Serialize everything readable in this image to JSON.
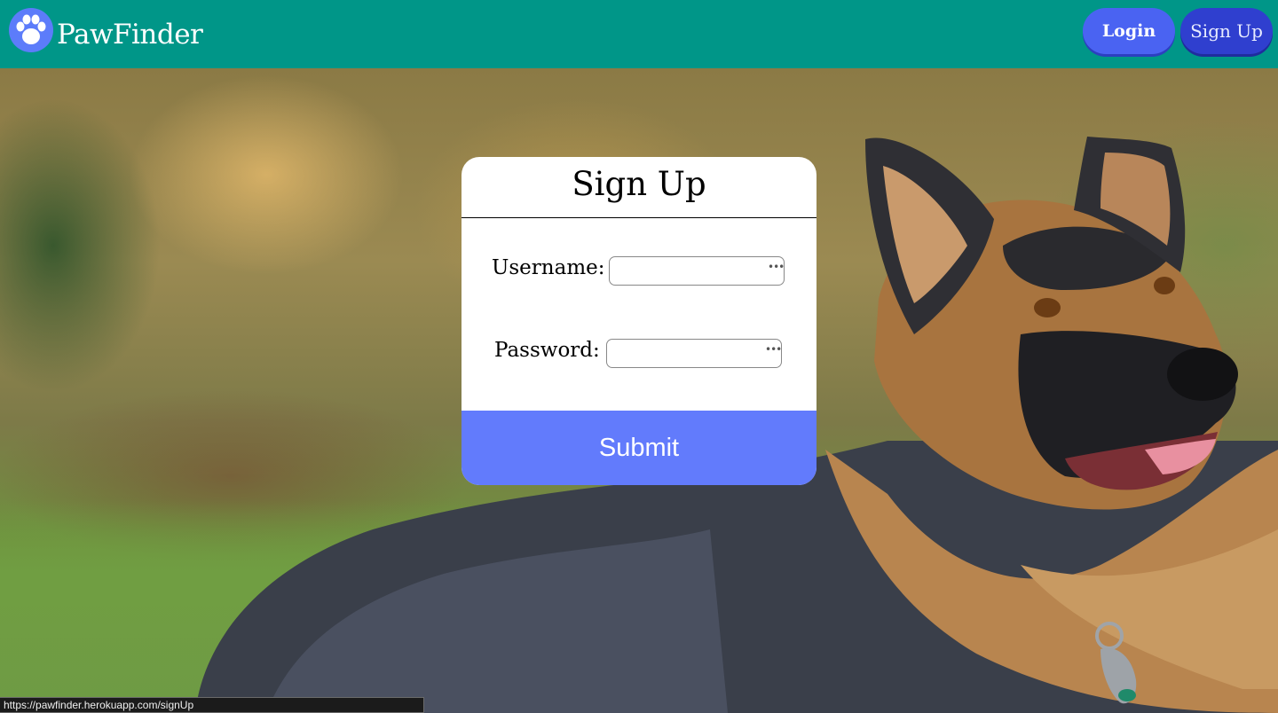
{
  "navbar": {
    "brand": "PawFinder",
    "logo_icon": "paw-icon",
    "login_label": "Login",
    "signup_label": "Sign Up",
    "colors": {
      "navbar_bg": "#009688",
      "login_bg": "#4a63f2",
      "signup_bg": "#2f3fcf",
      "logo_bg": "#5c7cfa"
    }
  },
  "form": {
    "title": "Sign Up",
    "username_label": "Username:",
    "username_value": "",
    "password_label": "Password:",
    "password_value": "",
    "password_manager_indicator": "•••",
    "submit_label": "Submit",
    "colors": {
      "card_bg": "#ffffff",
      "submit_bg": "#627bfc"
    }
  },
  "background": {
    "image_subject": "german-shepherd-dog-photo"
  },
  "status_bar": {
    "url": "https://pawfinder.herokuapp.com/signUp"
  }
}
